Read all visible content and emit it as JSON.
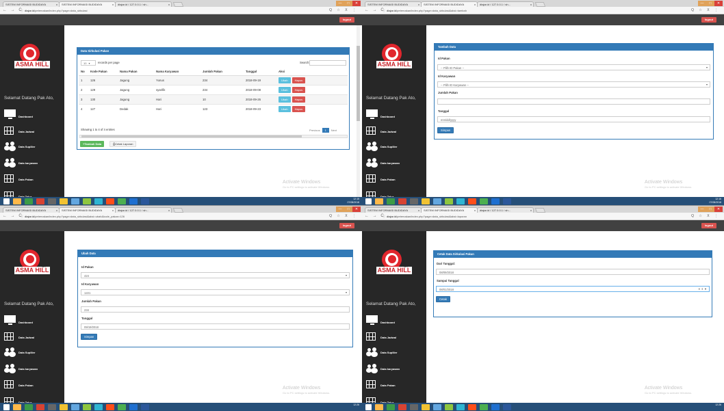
{
  "browser": {
    "tabs": [
      "SISTEM INFORMASI BUDIDAYA",
      "SISTEM INFORMASI BUDIDAYA",
      "dtajar.id / 127.0.0.1 / sh..."
    ],
    "tab_close": "x",
    "nav_buttons": "← → C",
    "url_lock": "ⓘ",
    "url_host": "dtajar.id",
    "tools": "Q ☆ X ⋮",
    "window_controls": [
      "—",
      "□",
      "✕"
    ]
  },
  "app": {
    "logout": "logout",
    "logo_text": "ASMA HILL",
    "logo_sub": "farm",
    "welcome": "Selamat Datang Pak Ato,",
    "menu": [
      "Dashboard",
      "Data Jadwal",
      "Data Supllier",
      "Data karyawan",
      "Data Pakan",
      "Data Telur"
    ]
  },
  "watermark": {
    "title": "Activate Windows",
    "sub": "Go to PC settings to activate Windows."
  },
  "tray": {
    "q1": {
      "time": "12:15",
      "date": "07/08/2018"
    },
    "q2": {
      "time": "12:16",
      "date": "07/08/2018"
    },
    "q3": {
      "time": "12:26",
      "date": ""
    },
    "q4": {
      "time": "12:26",
      "date": ""
    }
  },
  "screens": {
    "list": {
      "url": "/peternakan/index.php?page=data_sirkulasi",
      "title": "Data Sirkulasi Pakan",
      "length_value": "10",
      "length_suffix": "records per page",
      "search_label": "Search:",
      "columns": [
        "No",
        "Kode Pakan",
        "Nama Pakan",
        "Nama Karyawan",
        "Jumlah Pakan",
        "Tanggal",
        "Aksi"
      ],
      "rows": [
        [
          "1",
          "126",
          "Jagung",
          "Yunus",
          "234",
          "2018-09-19"
        ],
        [
          "2",
          "129",
          "Jagung",
          "syarifik",
          "234",
          "2018-09-08"
        ],
        [
          "3",
          "130",
          "Jagung",
          "Hari",
          "10",
          "2018-09-26"
        ],
        [
          "4",
          "127",
          "Dedak",
          "Hari",
          "123",
          "2018-09-23"
        ]
      ],
      "btn_edit": "Ubah",
      "btn_delete": "Hapus",
      "info": "Showing 1 to 4 of 4 entries",
      "pager_prev": "Previous",
      "pager_page": "1",
      "pager_next": "Next",
      "btn_add": "+Tambah Data",
      "btn_print": "Cetak Laporan"
    },
    "add": {
      "url": "/peternakan/index.php?page=data_sirkulasi&aksi=tambah",
      "title": "Tambah Data",
      "label_id_pakan": "Id Pakan",
      "select_pakan": "-- Pilih ID Pakan --",
      "label_id_karyawan": "Id Karyawan",
      "select_karyawan": "-- Pilih ID Karyawan --",
      "label_jumlah": "Jumlah Pakan",
      "jumlah_value": "",
      "label_tanggal": "Tanggal",
      "tanggal_placeholder": "mm/dd/yyyy",
      "btn_save": "Simpan"
    },
    "edit": {
      "url": "/peternakan/index.php?page=data_sirkulasi&aksi=ubah&kode_pakan=126",
      "title": "Ubah Data",
      "label_id_pakan": "Id Pakan",
      "select_pakan": "424",
      "label_id_karyawan": "Id Karyawan",
      "select_karyawan": "1221",
      "label_jumlah": "Jumlah Pakan",
      "jumlah_value": "234",
      "label_tanggal": "Tanggal",
      "tanggal_value": "09/19/2018",
      "btn_save": "Simpan"
    },
    "report": {
      "url": "/peternakan/index.php?page=data_sirkulasi&aksi=laporan",
      "title": "Cetak Data Sirkulasi Pakan",
      "label_from": "Dari Tanggal:",
      "from_value": "08/09/2018",
      "label_to": "Sampai Tanggal",
      "to_value": "08/01/2018",
      "to_controls": "✕ ⇕ ▼",
      "btn_print": "Cetak"
    }
  },
  "colors": {
    "primary": "#337ab7",
    "danger": "#d9534f",
    "info": "#5bc0de",
    "success": "#5cb85c",
    "sidebar": "#272727",
    "topbar": "#414141",
    "taskbar": "#264f78"
  }
}
